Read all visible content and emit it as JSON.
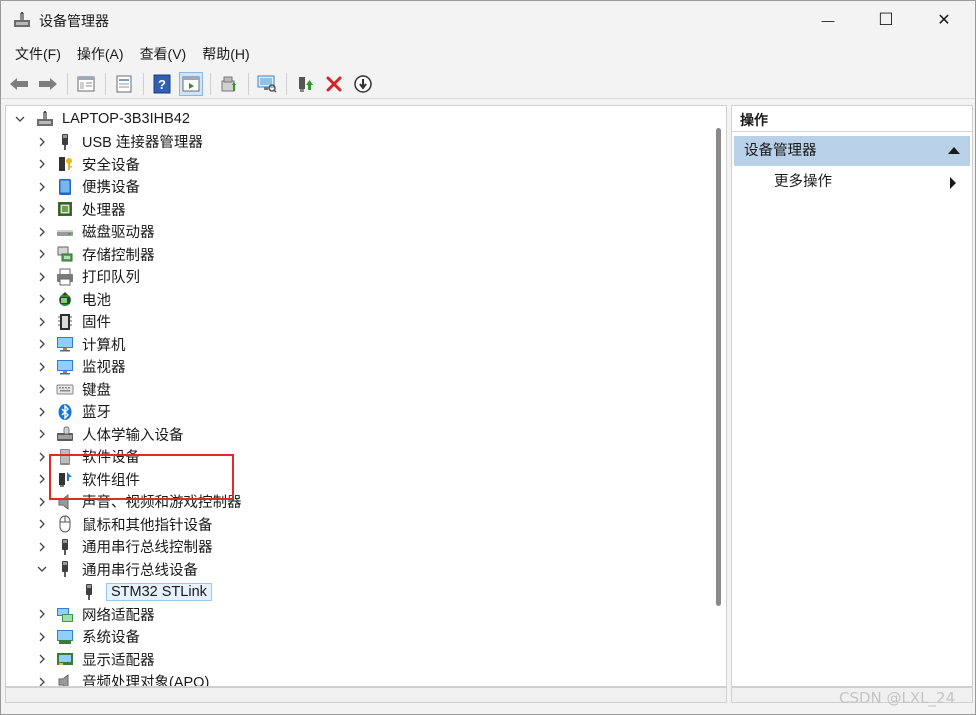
{
  "window": {
    "title": "设备管理器",
    "minimize_glyph": "—",
    "maximize_glyph": "☐",
    "close_glyph": "✕"
  },
  "menu": [
    {
      "label": "文件(F)"
    },
    {
      "label": "操作(A)"
    },
    {
      "label": "查看(V)"
    },
    {
      "label": "帮助(H)"
    }
  ],
  "toolbar": {
    "icons": [
      "back-arrow-icon",
      "forward-arrow-icon",
      "console-tree-icon",
      "properties-icon",
      "help-icon",
      "view-icon",
      "update-driver-icon",
      "scan-hardware-icon",
      "enable-device-icon",
      "uninstall-icon",
      "disable-device-icon"
    ]
  },
  "tree": {
    "root": "LAPTOP-3B3IHB42",
    "categories": [
      {
        "label": "USB 连接器管理器",
        "icon": "usb-icon",
        "expanded": false
      },
      {
        "label": "安全设备",
        "icon": "security-key-icon",
        "expanded": false
      },
      {
        "label": "便携设备",
        "icon": "portable-device-icon",
        "expanded": false
      },
      {
        "label": "处理器",
        "icon": "cpu-icon",
        "expanded": false
      },
      {
        "label": "磁盘驱动器",
        "icon": "disk-drive-icon",
        "expanded": false
      },
      {
        "label": "存储控制器",
        "icon": "storage-controller-icon",
        "expanded": false
      },
      {
        "label": "打印队列",
        "icon": "printer-icon",
        "expanded": false
      },
      {
        "label": "电池",
        "icon": "battery-icon",
        "expanded": false
      },
      {
        "label": "固件",
        "icon": "firmware-icon",
        "expanded": false
      },
      {
        "label": "计算机",
        "icon": "computer-icon",
        "expanded": false
      },
      {
        "label": "监视器",
        "icon": "monitor-icon",
        "expanded": false
      },
      {
        "label": "键盘",
        "icon": "keyboard-icon",
        "expanded": false
      },
      {
        "label": "蓝牙",
        "icon": "bluetooth-icon",
        "expanded": false
      },
      {
        "label": "人体学输入设备",
        "icon": "hid-icon",
        "expanded": false
      },
      {
        "label": "软件设备",
        "icon": "software-device-icon",
        "expanded": false
      },
      {
        "label": "软件组件",
        "icon": "software-component-icon",
        "expanded": false
      },
      {
        "label": "声音、视频和游戏控制器",
        "icon": "speaker-icon",
        "expanded": false
      },
      {
        "label": "鼠标和其他指针设备",
        "icon": "mouse-icon",
        "expanded": false
      },
      {
        "label": "通用串行总线控制器",
        "icon": "usb-icon",
        "expanded": false
      },
      {
        "label": "通用串行总线设备",
        "icon": "usb-icon",
        "expanded": true,
        "children": [
          {
            "label": "STM32 STLink",
            "icon": "usb-icon",
            "selected": true
          }
        ]
      },
      {
        "label": "网络适配器",
        "icon": "network-adapter-icon",
        "expanded": false
      },
      {
        "label": "系统设备",
        "icon": "system-device-icon",
        "expanded": false
      },
      {
        "label": "显示适配器",
        "icon": "display-adapter-icon",
        "expanded": false
      },
      {
        "label": "音频处理对象(APO)",
        "icon": "audio-apo-icon",
        "expanded": false
      }
    ]
  },
  "actions": {
    "header": "操作",
    "section": "设备管理器",
    "more": "更多操作"
  },
  "watermark": "CSDN @LXL_24",
  "colors": {
    "highlight_box": "#e02a2a",
    "actions_section_bg": "#b8d0e8",
    "selection_bg": "#e5f1fb"
  }
}
